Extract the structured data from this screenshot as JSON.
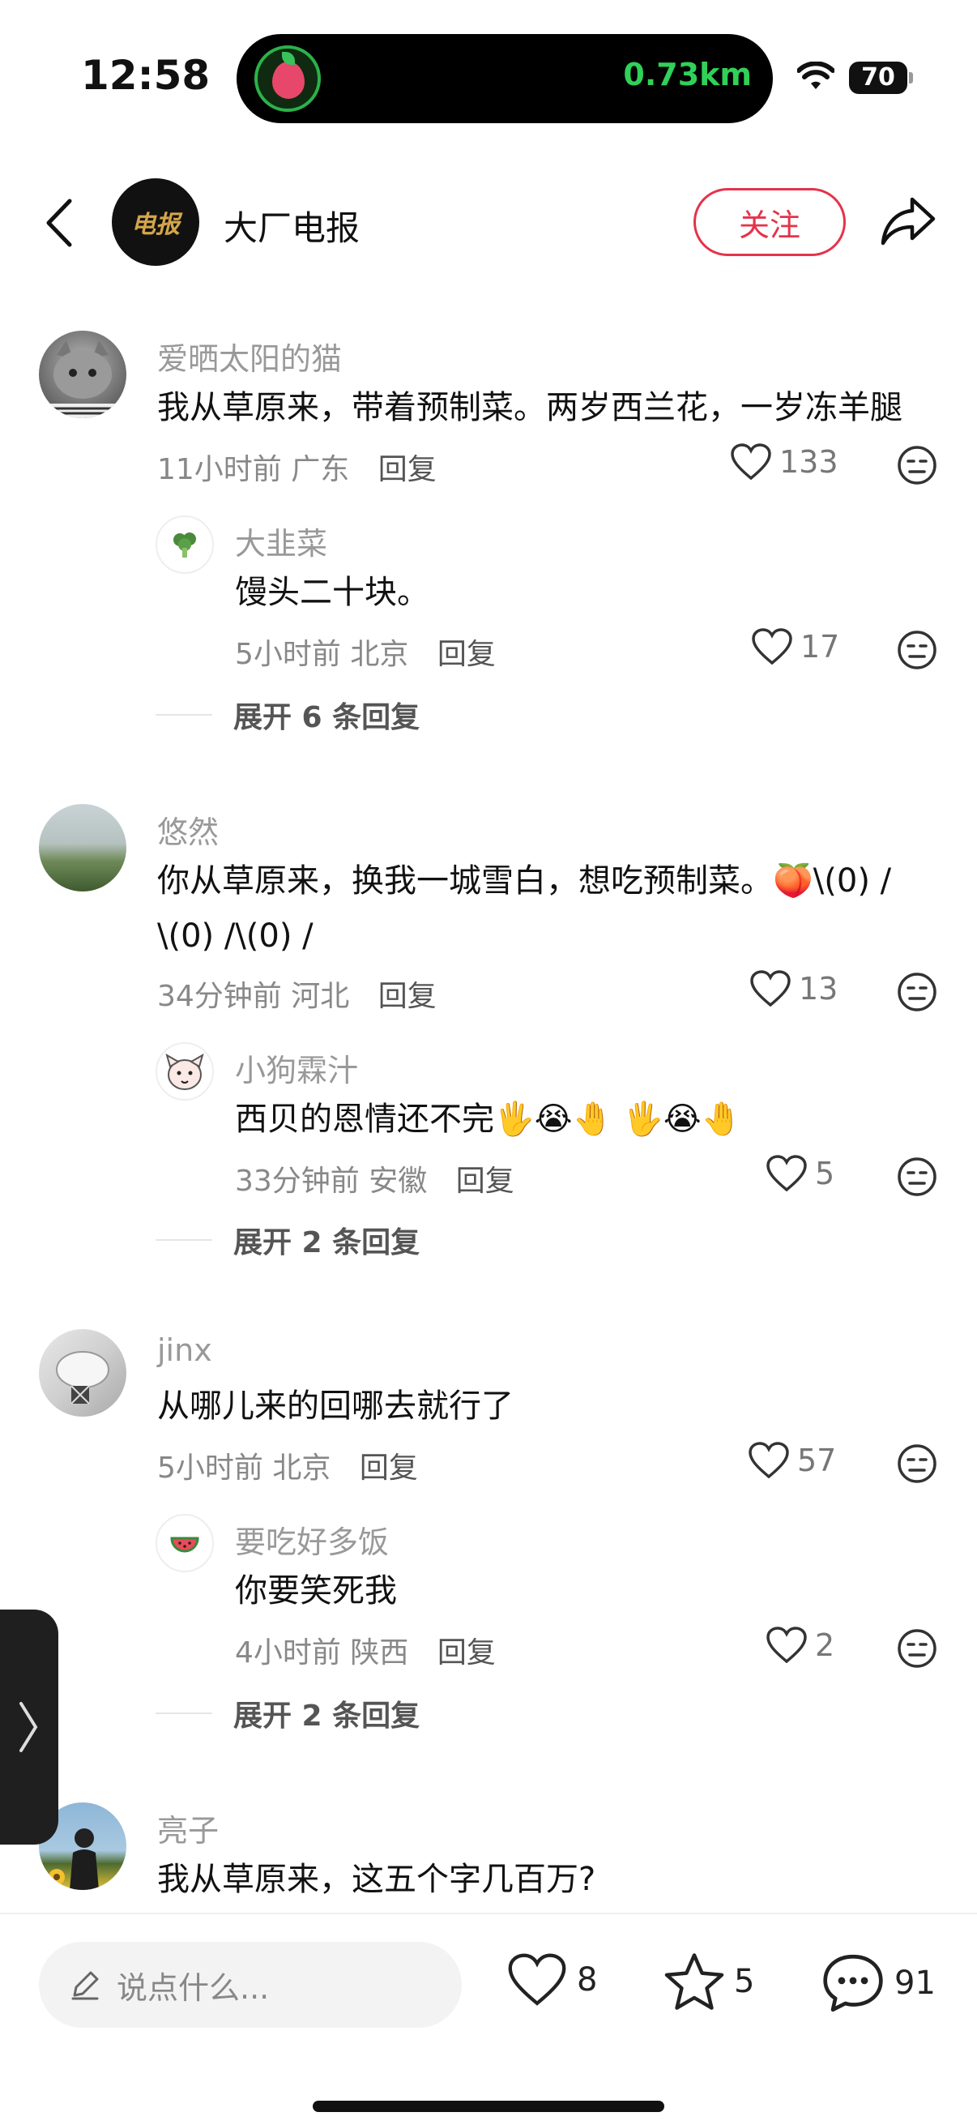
{
  "status_bar": {
    "time": "12:58",
    "distance": "0.73km",
    "battery": "70"
  },
  "header": {
    "avatar_text": "电报",
    "channel_name": "大厂电报",
    "follow_label": "关注"
  },
  "comments": [
    {
      "user": "爱晒太阳的猫",
      "text": "我从草原来，带着预制菜。两岁西兰花，一岁冻羊腿",
      "time": "11小时前",
      "region": "广东",
      "reply_label": "回复",
      "likes": "133",
      "replies": [
        {
          "user": "大韭菜",
          "text": "馒头二十块。",
          "time": "5小时前",
          "region": "北京",
          "reply_label": "回复",
          "likes": "17"
        }
      ],
      "expand_label": "展开 6 条回复"
    },
    {
      "user": "悠然",
      "text_line1": "你从草原来，换我一城雪白，想吃预制菜。🍑\\(0) /",
      "text_line2": "\\(0) /\\(0) /",
      "time": "34分钟前",
      "region": "河北",
      "reply_label": "回复",
      "likes": "13",
      "replies": [
        {
          "user": "小狗霖汁",
          "text": "西贝的恩情还不完🖐😭🤚 🖐😭🤚",
          "time": "33分钟前",
          "region": "安徽",
          "reply_label": "回复",
          "likes": "5"
        }
      ],
      "expand_label": "展开 2 条回复"
    },
    {
      "user": "jinx",
      "text": "从哪儿来的回哪去就行了",
      "time": "5小时前",
      "region": "北京",
      "reply_label": "回复",
      "likes": "57",
      "replies": [
        {
          "user": "要吃好多饭",
          "text": "你要笑死我",
          "time": "4小时前",
          "region": "陕西",
          "reply_label": "回复",
          "likes": "2"
        }
      ],
      "expand_label": "展开 2 条回复"
    },
    {
      "user": "亮子",
      "text": "我从草原来，这五个字几百万?"
    }
  ],
  "bottom_bar": {
    "input_placeholder": "说点什么...",
    "likes": "8",
    "favorites": "5",
    "comments": "91"
  }
}
